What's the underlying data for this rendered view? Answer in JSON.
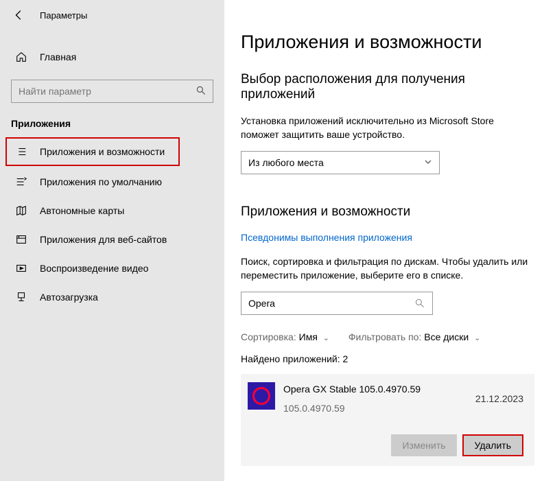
{
  "header": {
    "title": "Параметры"
  },
  "sidebar": {
    "home": "Главная",
    "search_placeholder": "Найти параметр",
    "group": "Приложения",
    "items": [
      {
        "label": "Приложения и возможности"
      },
      {
        "label": "Приложения по умолчанию"
      },
      {
        "label": "Автономные карты"
      },
      {
        "label": "Приложения для веб-сайтов"
      },
      {
        "label": "Воспроизведение видео"
      },
      {
        "label": "Автозагрузка"
      }
    ]
  },
  "main": {
    "title": "Приложения и возможности",
    "source_heading": "Выбор расположения для получения приложений",
    "source_desc": "Установка приложений исключительно из Microsoft Store поможет защитить ваше устройство.",
    "source_value": "Из любого места",
    "section_heading": "Приложения и возможности",
    "alias_link": "Псевдонимы выполнения приложения",
    "search_desc": "Поиск, сортировка и фильтрация по дискам. Чтобы удалить или переместить приложение, выберите его в списке.",
    "search_value": "Opera",
    "sort_label": "Сортировка:",
    "sort_value": "Имя",
    "filter_label": "Фильтровать по:",
    "filter_value": "Все диски",
    "found_label": "Найдено приложений:",
    "found_count": "2",
    "app": {
      "name": "Opera GX Stable 105.0.4970.59",
      "version": "105.0.4970.59",
      "date": "21.12.2023",
      "modify": "Изменить",
      "uninstall": "Удалить"
    }
  }
}
